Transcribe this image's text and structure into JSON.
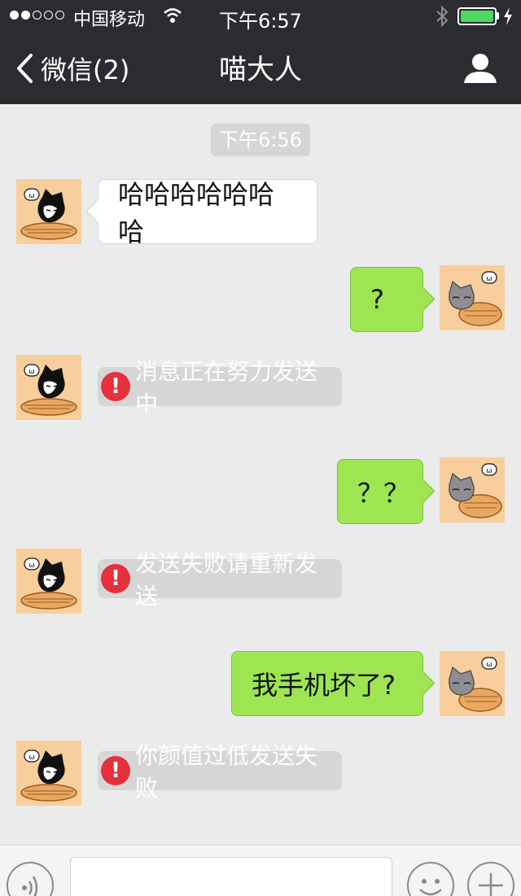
{
  "status_bar": {
    "carrier": "中国移动",
    "time": "下午6:57",
    "signal_filled": 2,
    "signal_total": 5,
    "battery_level": 1.0,
    "battery_color": "#4cd964",
    "icons": [
      "wifi-icon",
      "bluetooth-icon",
      "battery-icon",
      "charging-icon"
    ]
  },
  "nav": {
    "back_label": "微信(2)",
    "title": "喵大人",
    "back_icon": "chevron-left-icon",
    "profile_icon": "person-icon"
  },
  "chat": {
    "timestamp": "下午6:56",
    "messages": [
      {
        "type": "incoming",
        "text": "哈哈哈哈哈哈哈"
      },
      {
        "type": "outgoing",
        "text": "?"
      },
      {
        "type": "system",
        "icon": "exclamation-icon",
        "text": "消息正在努力发送中"
      },
      {
        "type": "outgoing",
        "text": "？？"
      },
      {
        "type": "system",
        "icon": "exclamation-icon",
        "text": "发送失败请重新发送"
      },
      {
        "type": "outgoing",
        "text": "我手机坏了?"
      },
      {
        "type": "system",
        "icon": "exclamation-icon",
        "text": "你颜值过低发送失败"
      }
    ],
    "error_icon_glyph": "!",
    "colors": {
      "outgoing_bubble": "#9ee651",
      "incoming_bubble": "#ffffff",
      "error": "#e8303a",
      "header": "#2b2c30"
    }
  },
  "input_bar": {
    "voice_icon": "voice-icon",
    "emoji_icon": "emoji-icon",
    "plus_icon": "plus-icon"
  }
}
